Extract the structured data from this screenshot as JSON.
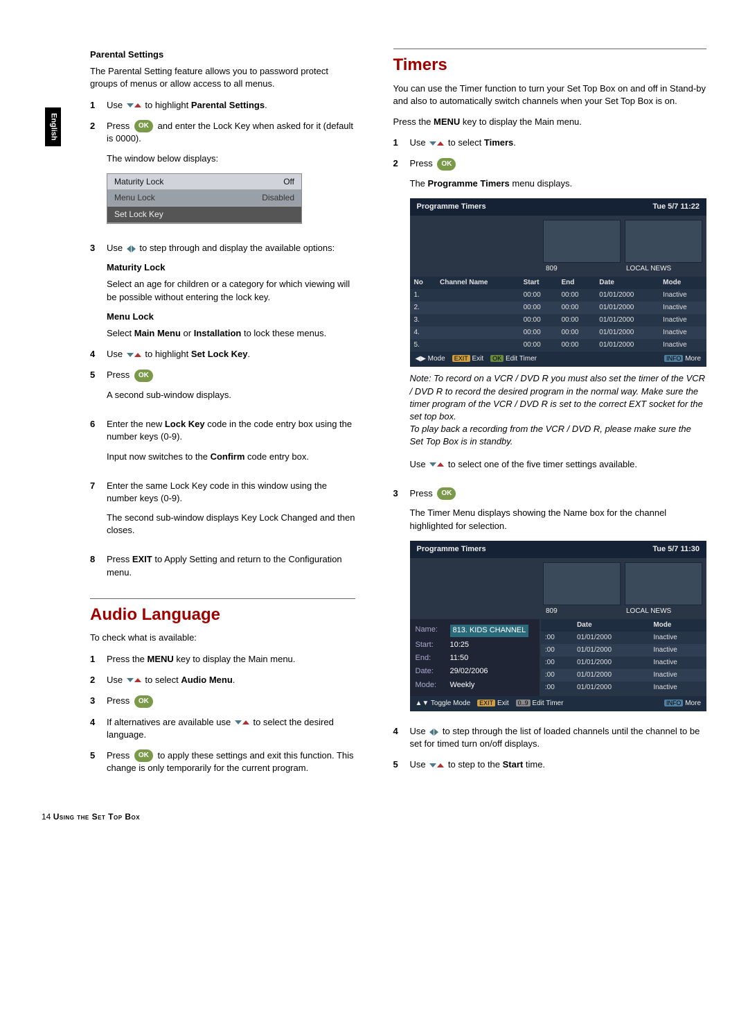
{
  "side_tab": "English",
  "left": {
    "parental": {
      "heading": "Parental Settings",
      "intro": "The Parental Setting feature allows you to password protect groups of menus or allow access to all menus.",
      "steps": [
        {
          "n": "1",
          "pre": "Use ",
          "icon": "updown",
          "post": " to highlight ",
          "bold": "Parental Settings",
          "after": "."
        },
        {
          "n": "2",
          "pre": "Press ",
          "icon": "ok",
          "post": " and enter the Lock Key when asked for it (default is 0000)."
        }
      ],
      "window_note": "The window below displays:",
      "window_rows": [
        {
          "label": "Maturity Lock",
          "value": "Off"
        },
        {
          "label": "Menu Lock",
          "value": "Disabled"
        },
        {
          "label": "Set Lock Key",
          "value": ""
        }
      ],
      "step3": {
        "n": "3",
        "pre": "Use ",
        "icon": "leftright",
        "post": " to step through and display the available options:"
      },
      "maturity_heading": "Maturity Lock",
      "maturity_text": "Select an age for children or a category for which viewing will be possible without entering the lock key.",
      "menu_lock_heading": "Menu Lock",
      "menu_lock_text_pre": "Select ",
      "menu_lock_bold1": "Main Menu",
      "menu_lock_mid": " or ",
      "menu_lock_bold2": "Installation",
      "menu_lock_after": " to lock these menus.",
      "step4": {
        "n": "4",
        "pre": "Use ",
        "icon": "updown",
        "post": " to highlight ",
        "bold": "Set Lock Key",
        "after": "."
      },
      "step5": {
        "n": "5",
        "pre": "Press ",
        "icon": "ok"
      },
      "step5_after": "A second sub-window displays.",
      "step6": {
        "n": "6",
        "pre": "Enter the new ",
        "bold": "Lock Key",
        "post": " code in the code entry box using the number keys (0-9)."
      },
      "step6_after_pre": "Input now switches to the ",
      "step6_after_bold": "Confirm",
      "step6_after_post": " code entry box.",
      "step7": {
        "n": "7",
        "text": "Enter the same Lock Key code in this window using the number keys (0-9)."
      },
      "step7_after": "The second sub-window displays Key Lock Changed and then closes.",
      "step8": {
        "n": "8",
        "pre": "Press ",
        "bold": "EXIT",
        "post": " to Apply Setting and return to the Configuration menu."
      }
    },
    "audio": {
      "heading": "Audio Language",
      "intro": "To check what is available:",
      "steps": [
        {
          "n": "1",
          "pre": "Press the ",
          "bold": "MENU",
          "post": " key to display the Main menu."
        },
        {
          "n": "2",
          "pre": "Use ",
          "icon": "updown",
          "post": " to select ",
          "bold": "Audio Menu",
          "after": "."
        },
        {
          "n": "3",
          "pre": "Press ",
          "icon": "ok"
        },
        {
          "n": "4",
          "pre": "If alternatives are available use ",
          "icon": "updown",
          "post": " to select the desired language."
        },
        {
          "n": "5",
          "pre": "Press ",
          "icon": "ok",
          "post": " to apply these settings and exit this function. This change is only temporarily for the current program."
        }
      ]
    }
  },
  "right": {
    "heading": "Timers",
    "intro": "You can use the Timer function to turn your Set Top Box on and off in Stand-by and also to automatically switch channels when your Set Top Box is on.",
    "menu_line_pre": "Press the ",
    "menu_line_bold": "MENU",
    "menu_line_post": " key to display the Main menu.",
    "step1": {
      "n": "1",
      "pre": "Use ",
      "icon": "updown",
      "post": " to select ",
      "bold": "Timers",
      "after": "."
    },
    "step2": {
      "n": "2",
      "pre": "Press ",
      "icon": "ok"
    },
    "prog_menu_pre": "The ",
    "prog_menu_bold": "Programme Timers",
    "prog_menu_post": " menu displays.",
    "window1": {
      "title": "Programme Timers",
      "clock": "Tue 5/7 11:22",
      "preview_left": " ",
      "preview_right": " ",
      "preview_left_label": "809",
      "preview_right_label": "LOCAL NEWS",
      "cols": [
        "No",
        "Channel Name",
        "Start",
        "End",
        "Date",
        "Mode"
      ],
      "rows": [
        [
          "1.",
          "",
          "00:00",
          "00:00",
          "01/01/2000",
          "Inactive"
        ],
        [
          "2.",
          "",
          "00:00",
          "00:00",
          "01/01/2000",
          "Inactive"
        ],
        [
          "3.",
          "",
          "00:00",
          "00:00",
          "01/01/2000",
          "Inactive"
        ],
        [
          "4.",
          "",
          "00:00",
          "00:00",
          "01/01/2000",
          "Inactive"
        ],
        [
          "5.",
          "",
          "00:00",
          "00:00",
          "01/01/2000",
          "Inactive"
        ]
      ],
      "footer": [
        "◀▶ Mode",
        "EXIT Exit",
        "OK Edit Timer",
        "INFO More"
      ]
    },
    "note": "Note:  To record on a VCR / DVD R you must also set the timer of the VCR / DVD R to record the desired program in the normal way. Make sure the timer program of the VCR / DVD R is set to the correct EXT socket for the set top box.\nTo play back a recording from the VCR / DVD R, please make sure the Set Top Box is in standby.",
    "use_line_pre": "Use ",
    "use_line_post": " to select one of the five timer settings available.",
    "step3": {
      "n": "3",
      "pre": "Press ",
      "icon": "ok"
    },
    "step3_after": "The Timer Menu displays showing the Name box for the channel highlighted for selection.",
    "window2": {
      "title": "Programme Timers",
      "clock": "Tue 5/7 11:30",
      "preview_left_label": "809",
      "preview_right_label": "LOCAL NEWS",
      "form": [
        {
          "lbl": "Name:",
          "val": "813. KIDS CHANNEL",
          "hl": true
        },
        {
          "lbl": "Start:",
          "val": "10:25"
        },
        {
          "lbl": "End:",
          "val": "11:50"
        },
        {
          "lbl": "Date:",
          "val": "29/02/2006"
        },
        {
          "lbl": "Mode:",
          "val": "Weekly"
        }
      ],
      "list_cols": [
        "",
        "Date",
        "Mode"
      ],
      "list_rows": [
        [
          ":00",
          "01/01/2000",
          "Inactive"
        ],
        [
          ":00",
          "01/01/2000",
          "Inactive"
        ],
        [
          ":00",
          "01/01/2000",
          "Inactive"
        ],
        [
          ":00",
          "01/01/2000",
          "Inactive"
        ],
        [
          ":00",
          "01/01/2000",
          "Inactive"
        ]
      ],
      "footer": [
        "▲▼ Toggle Mode",
        "EXIT Exit",
        "0..9 Edit Timer",
        "INFO More"
      ]
    },
    "step4": {
      "n": "4",
      "pre": "Use ",
      "icon": "leftright",
      "post": " to step through the list of loaded channels until the channel to be set for timed turn on/off displays."
    },
    "step5": {
      "n": "5",
      "pre": "Use ",
      "icon": "updown",
      "post": " to step to the ",
      "bold": "Start",
      "after": " time."
    }
  },
  "footer": {
    "page": "14",
    "text": "Using the Set Top Box"
  }
}
